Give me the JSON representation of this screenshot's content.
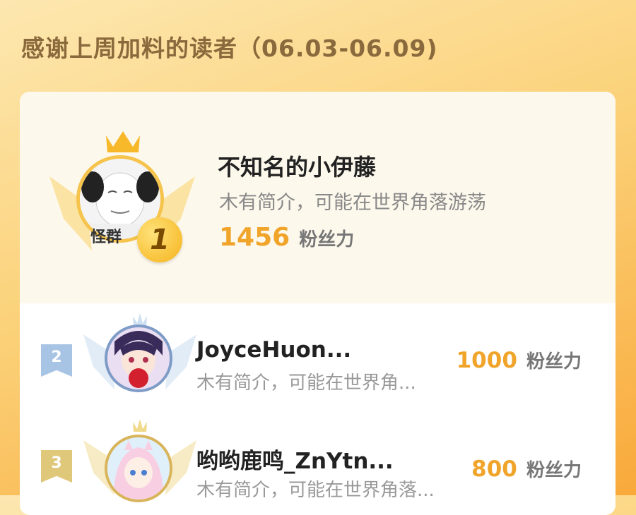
{
  "header": {
    "title": "感谢上周加料的读者（06.03-06.09)"
  },
  "fans_label": "粉丝力",
  "first": {
    "rank": "1",
    "name": "不知名的小伊藤",
    "bio": "木有简介，可能在世界角落游荡",
    "fans": "1456",
    "avatar_text": "怪群"
  },
  "ranks": [
    {
      "rank": "2",
      "name": "JoyceHuon...",
      "bio": "木有简介，可能在世界角...",
      "fans": "1000"
    },
    {
      "rank": "3",
      "name": "哟哟鹿鸣_ZnYtn...",
      "bio": "木有简介，可能在世界角落...",
      "fans": "800"
    }
  ],
  "colors": {
    "gold": "#f0a42a",
    "silver_tag": "#a8c4e4",
    "bronze_tag": "#e0c87a"
  },
  "icons": [
    "crown-icon",
    "wings-icon",
    "rank-ribbon-icon"
  ]
}
